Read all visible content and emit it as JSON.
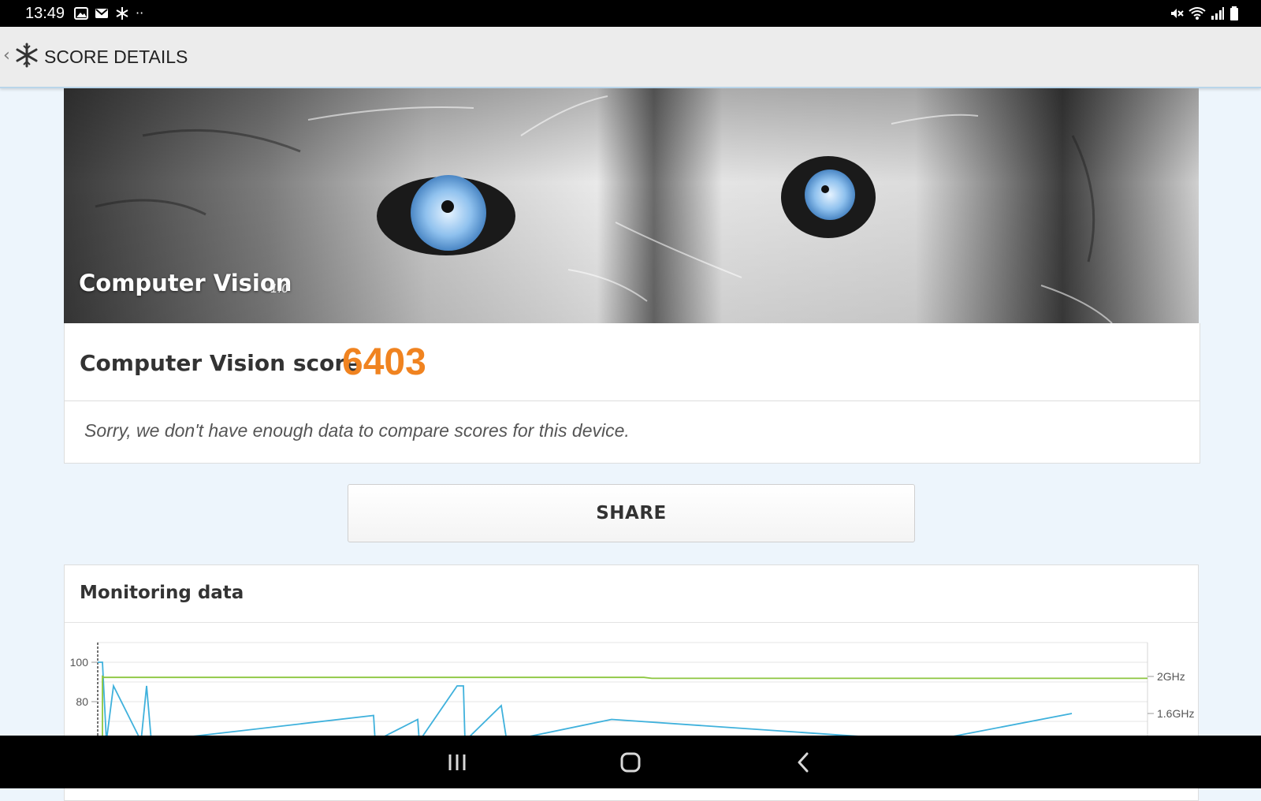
{
  "status_bar": {
    "time": "13:49",
    "left_icons": [
      "image-icon",
      "gmail-icon",
      "snowflake-icon",
      "more-dots-icon"
    ],
    "right_icons": [
      "mute-icon",
      "wifi-icon",
      "signal-icon",
      "battery-icon"
    ]
  },
  "app_bar": {
    "title": "SCORE DETAILS"
  },
  "hero": {
    "title": "Computer Vision",
    "version": "1.0"
  },
  "score": {
    "label": "Computer Vision score",
    "value": "6403",
    "value_color": "#f08320"
  },
  "comparison_note": "Sorry, we don't have enough data to compare scores for this device.",
  "share_button": {
    "label": "SHARE"
  },
  "monitoring": {
    "title": "Monitoring data"
  },
  "chart_data": {
    "type": "line",
    "left_axis_ticks": [
      "100",
      "80"
    ],
    "right_axis_ticks": [
      "2GHz",
      "1.6GHz"
    ],
    "series": [
      {
        "color": "#3fb1dc",
        "x": [
          0,
          1,
          2,
          3,
          4,
          5,
          6,
          7,
          8,
          9,
          10,
          11,
          12,
          13,
          14,
          15,
          16,
          17,
          18
        ],
        "values": [
          100,
          100,
          60,
          88,
          60,
          88,
          60,
          73,
          60,
          71,
          60,
          88,
          88,
          60,
          78,
          60,
          71,
          60,
          74
        ]
      },
      {
        "color": "#8cc63f",
        "x": [
          0,
          1,
          2,
          3
        ],
        "values": [
          2.0,
          1.99,
          1.99,
          1.98
        ]
      }
    ]
  },
  "nav_bar": {
    "buttons": [
      "recents-icon",
      "home-icon",
      "back-icon"
    ]
  }
}
